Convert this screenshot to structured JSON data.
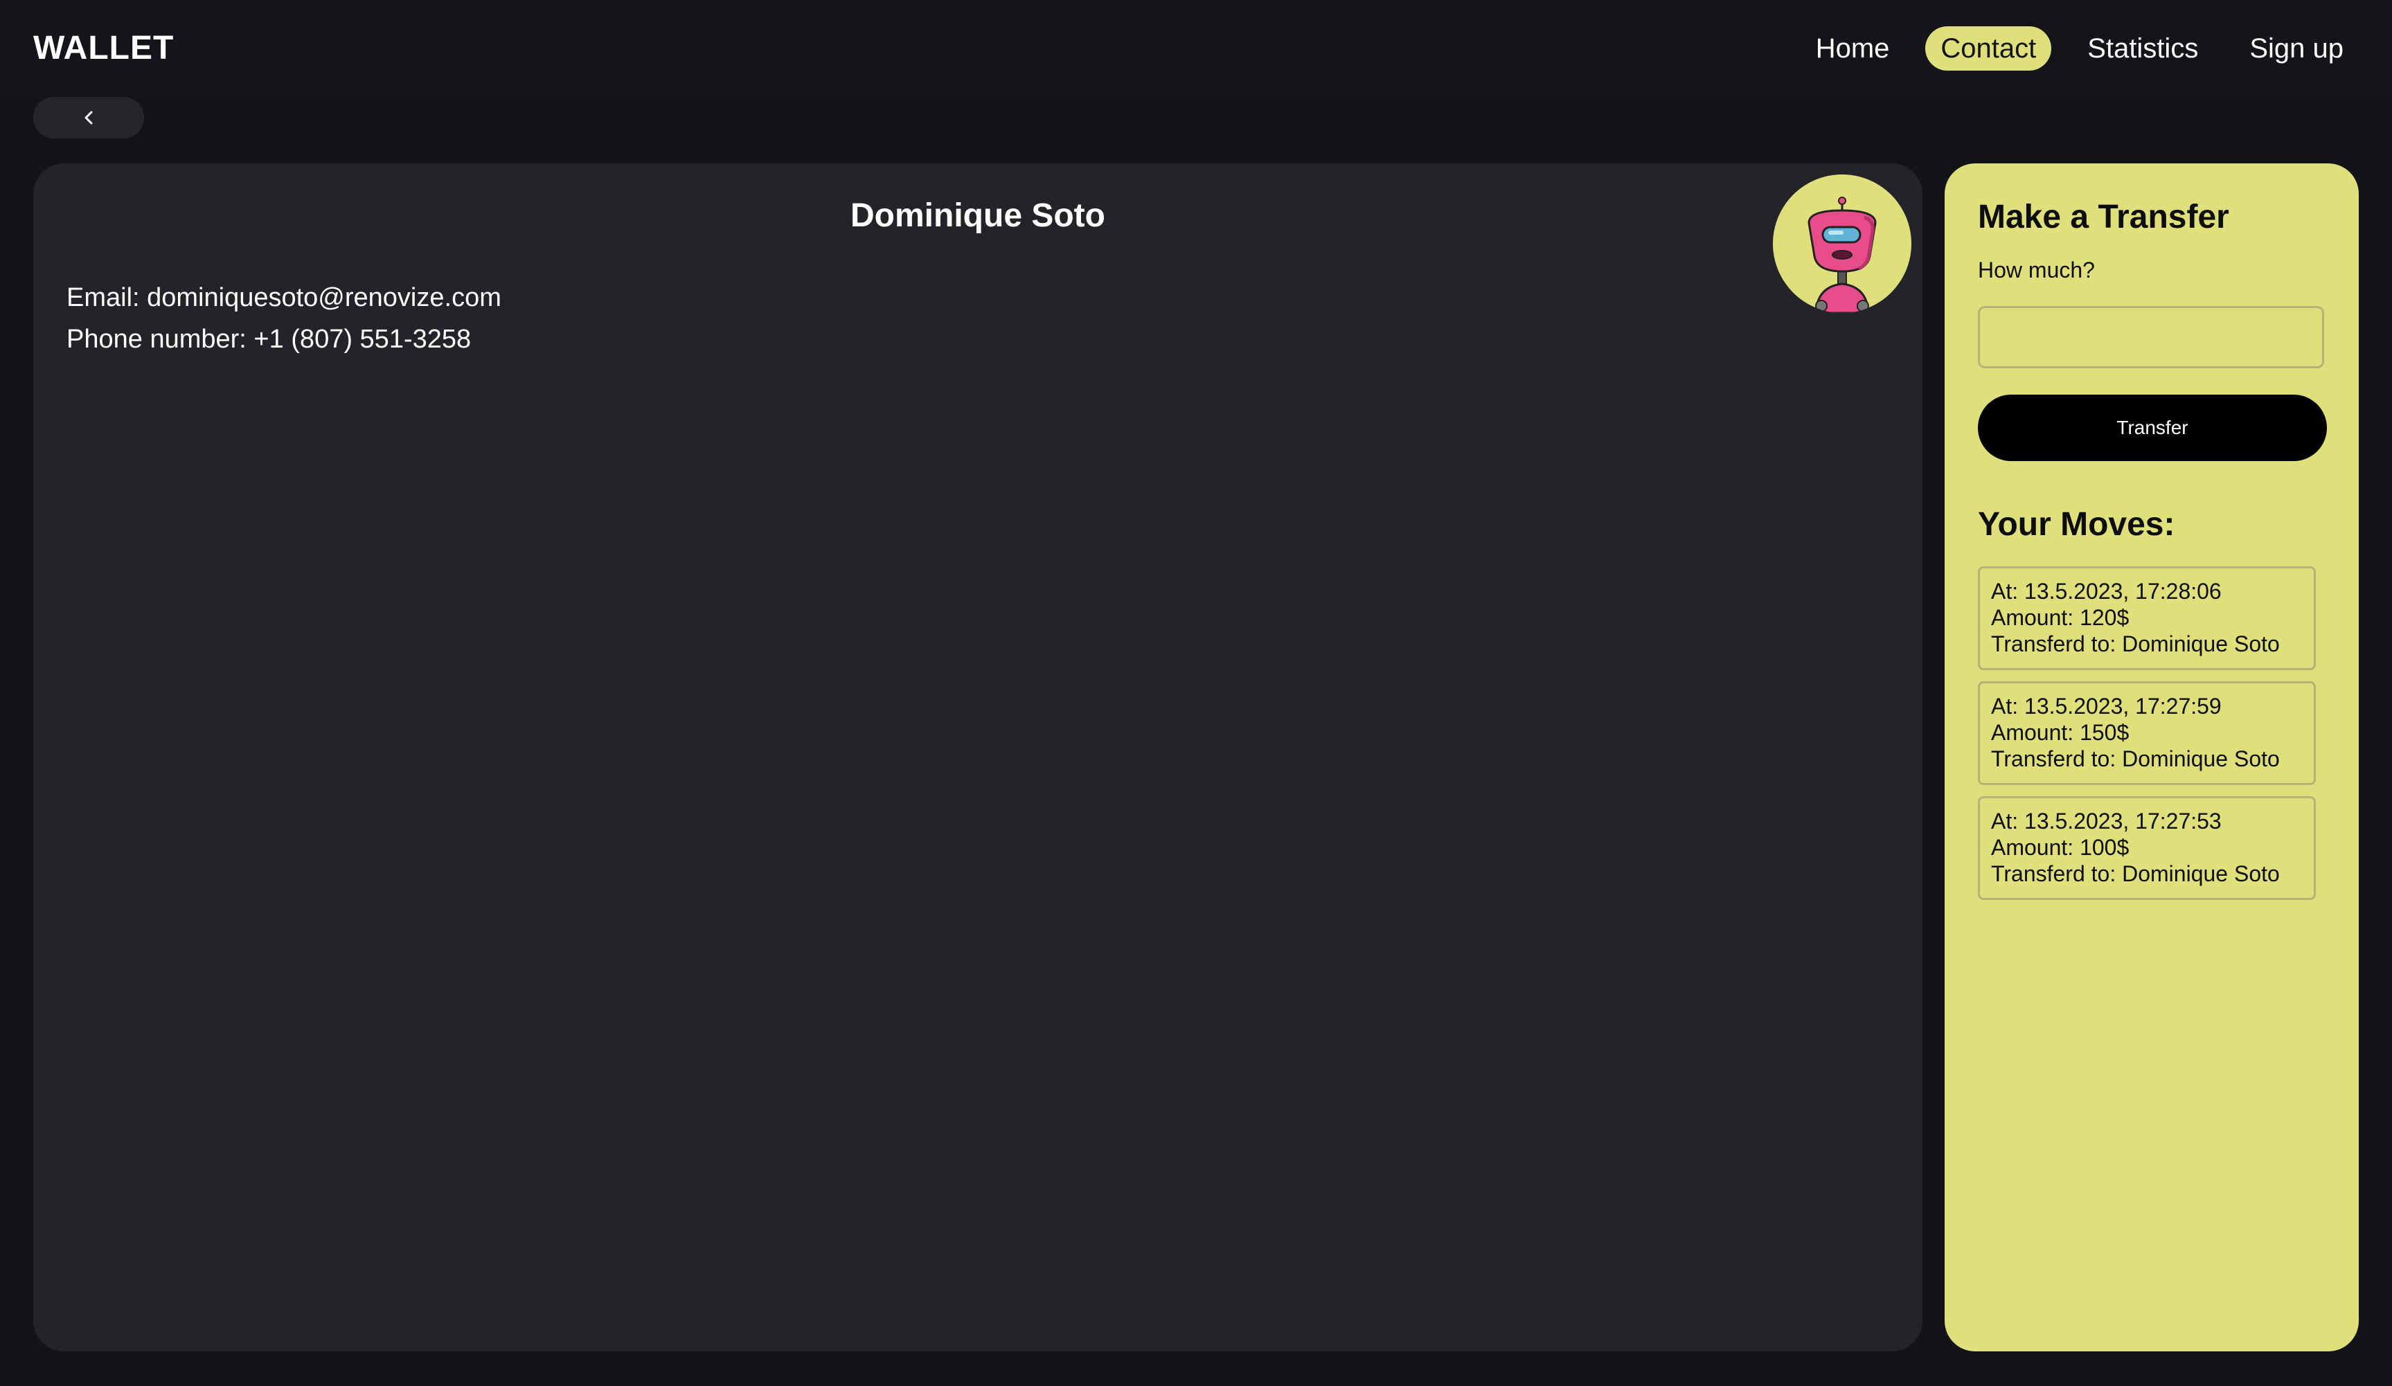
{
  "header": {
    "logo": "WALLET",
    "nav": [
      {
        "label": "Home",
        "active": false
      },
      {
        "label": "Contact",
        "active": true
      },
      {
        "label": "Statistics",
        "active": false
      },
      {
        "label": "Sign up",
        "active": false
      }
    ]
  },
  "back_button": {
    "icon": "chevron-left-icon"
  },
  "contact": {
    "name": "Dominique Soto",
    "email_line": "Email: dominiquesoto@renovize.com",
    "phone_line": "Phone number: +1 (807) 551-3258",
    "avatar_icon": "robot-avatar-icon"
  },
  "transfer": {
    "title": "Make a Transfer",
    "amount_label": "How much?",
    "amount_value": "",
    "button_label": "Transfer"
  },
  "moves": {
    "title": "Your Moves:",
    "items": [
      {
        "at": "At: 13.5.2023, 17:28:06",
        "amount": "Amount: 120$",
        "to": "Transferd to: Dominique Soto"
      },
      {
        "at": "At: 13.5.2023, 17:27:59",
        "amount": "Amount: 150$",
        "to": "Transferd to: Dominique Soto"
      },
      {
        "at": "At: 13.5.2023, 17:27:53",
        "amount": "Amount: 100$",
        "to": "Transferd to: Dominique Soto"
      }
    ]
  },
  "colors": {
    "background": "#131417",
    "card": "#232428",
    "accent": "#dfdf7c",
    "button": "#000000"
  }
}
